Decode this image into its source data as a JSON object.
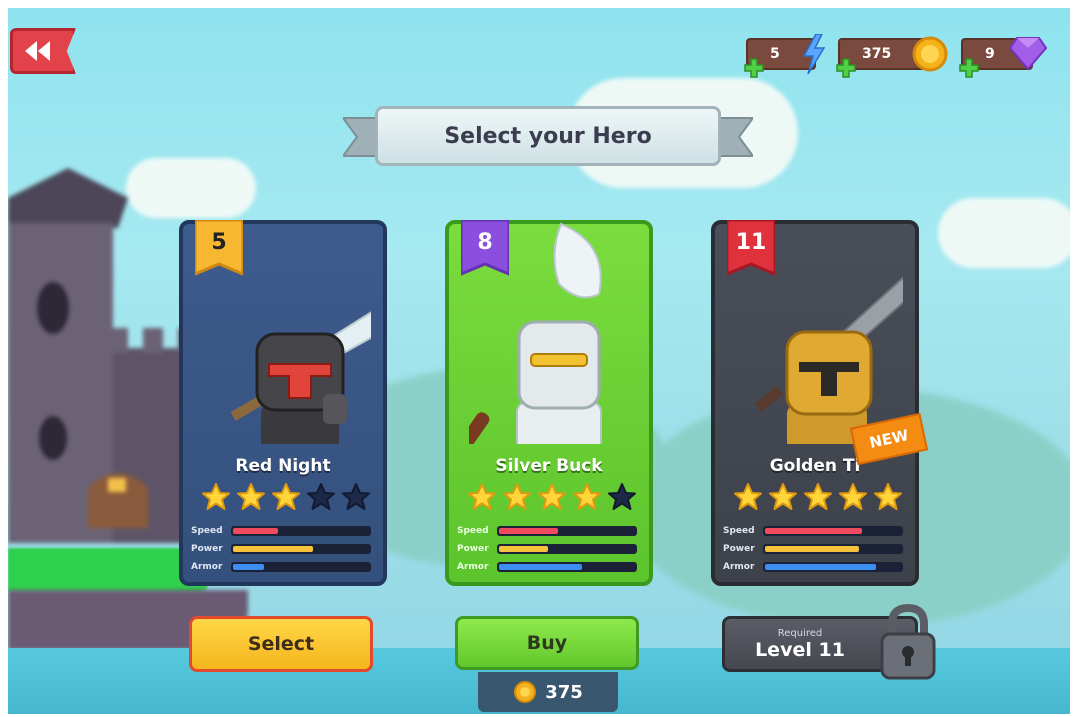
{
  "header": {
    "title": "Select your Hero"
  },
  "resources": [
    {
      "name": "energy",
      "value": "5",
      "icon": "lightning-icon",
      "color": "#5aa6ff"
    },
    {
      "name": "coins",
      "value": "375",
      "icon": "coin-icon",
      "color": "#f6b21b"
    },
    {
      "name": "gems",
      "value": "9",
      "icon": "gem-icon",
      "color": "#a25ee8"
    }
  ],
  "heroes": [
    {
      "level": "5",
      "name": "Red Night",
      "stars": 3,
      "stats": {
        "speed": 0.35,
        "power": 0.6,
        "armor": 0.25
      },
      "stat_labels": {
        "speed": "Speed",
        "power": "Power",
        "armor": "Armor"
      },
      "card_color": "#3e5b8e"
    },
    {
      "level": "8",
      "name": "Silver Buck",
      "stars": 4,
      "stats": {
        "speed": 0.45,
        "power": 0.38,
        "armor": 0.62
      },
      "stat_labels": {
        "speed": "Speed",
        "power": "Power",
        "armor": "Armor"
      },
      "card_color": "#6fd234"
    },
    {
      "level": "11",
      "name": "Golden Ti",
      "stars": 5,
      "stats": {
        "speed": 0.72,
        "power": 0.7,
        "armor": 0.82
      },
      "stat_labels": {
        "speed": "Speed",
        "power": "Power",
        "armor": "Armor"
      },
      "card_color": "#454952",
      "badge": "NEW"
    }
  ],
  "actions": {
    "select_label": "Select",
    "buy_label": "Buy",
    "buy_price": "375",
    "required_label": "Required",
    "required_level": "Level 11"
  }
}
